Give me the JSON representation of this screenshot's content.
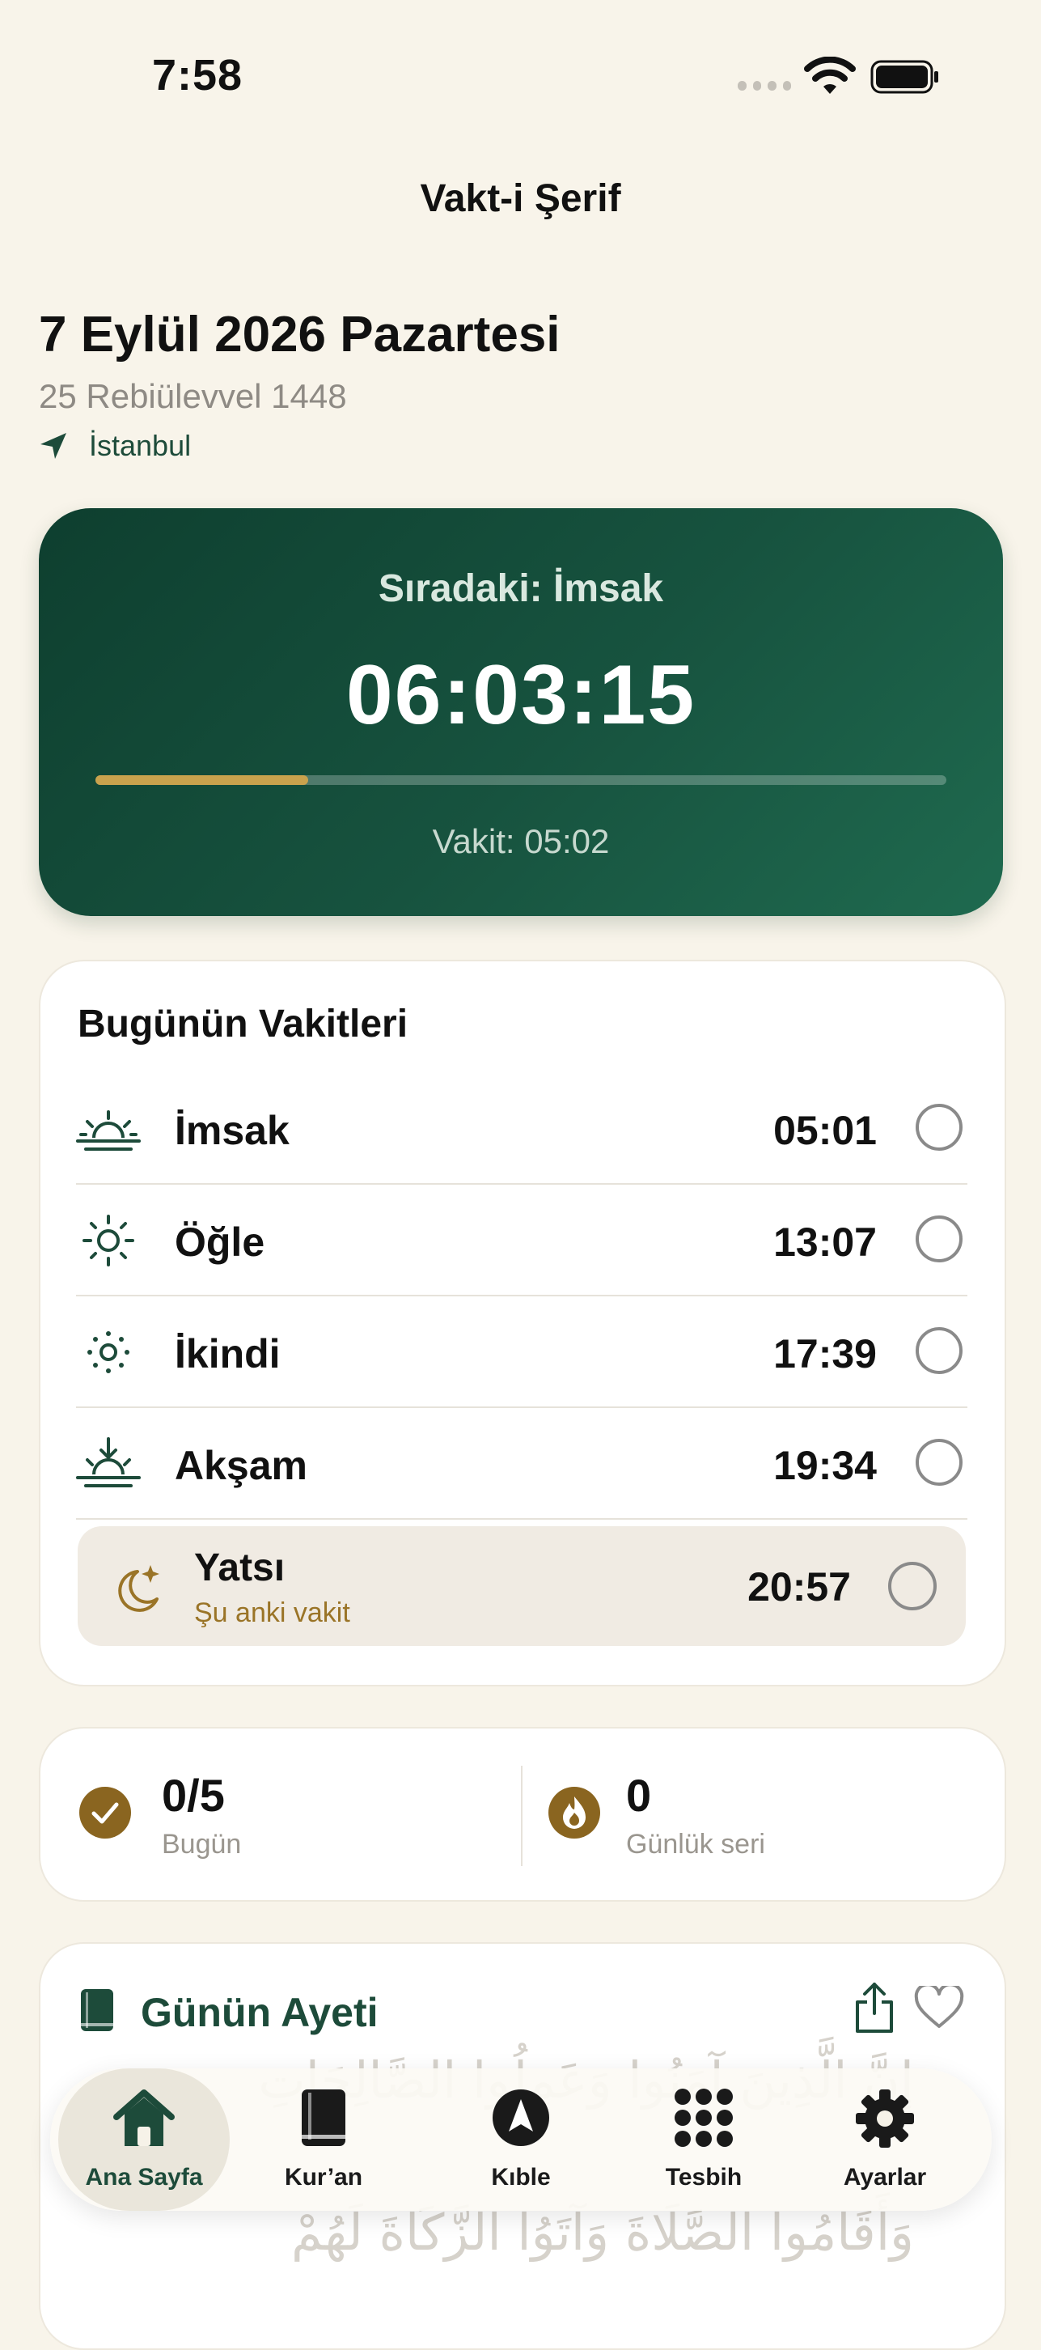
{
  "status_bar": {
    "time": "7:58"
  },
  "nav": {
    "title": "Vakt-i Şerif"
  },
  "header": {
    "date": "7 Eylül 2026 Pazartesi",
    "hijri": "25 Rebiülevvel 1448",
    "location": "İstanbul",
    "location_icon": "location-arrow-icon"
  },
  "next_prayer": {
    "label": "Sıradaki: İmsak",
    "countdown": "06:03:15",
    "progress": 0.25,
    "vakit": "Vakit: 05:02",
    "accent": "#c9a24d"
  },
  "today": {
    "title": "Bugünün Vakitleri",
    "prayers": [
      {
        "name": "İmsak",
        "time": "05:01",
        "icon": "sunrise-icon"
      },
      {
        "name": "Öğle",
        "time": "13:07",
        "icon": "sun-icon"
      },
      {
        "name": "İkindi",
        "time": "17:39",
        "icon": "sun-small-icon"
      },
      {
        "name": "Akşam",
        "time": "19:34",
        "icon": "sunset-icon"
      }
    ],
    "current": {
      "name": "Yatsı",
      "subtitle": "Şu anki vakit",
      "time": "20:57",
      "icon": "moon-stars-icon"
    }
  },
  "stats": {
    "today_value": "0/5",
    "today_label": "Bugün",
    "streak_value": "0",
    "streak_label": "Günlük seri"
  },
  "verse": {
    "title": "Günün Ayeti",
    "arabic_line1": "إِنَّ الَّذِينَ آمَنُوا وَعَمِلُوا الصَّالِحَاتِ",
    "arabic_line2": "وَأَقَامُوا الصَّلَاةَ وَآتَوُا الزَّكَاةَ لَهُمْ"
  },
  "tabs": [
    {
      "label": "Ana Sayfa",
      "icon": "house-icon",
      "active": true
    },
    {
      "label": "Kur’an",
      "icon": "book-icon"
    },
    {
      "label": "Kıble",
      "icon": "compass-icon"
    },
    {
      "label": "Tesbih",
      "icon": "grid-dots-icon"
    },
    {
      "label": "Ayarlar",
      "icon": "gear-icon"
    }
  ],
  "colors": {
    "background": "#f8f4ea",
    "green": "#1d4b3a",
    "gold": "#9a7427"
  }
}
